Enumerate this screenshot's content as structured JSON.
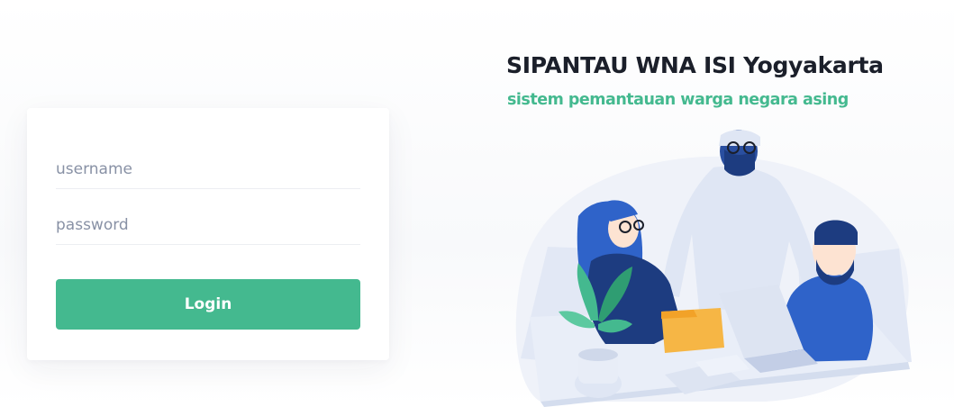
{
  "login": {
    "username_placeholder": "username",
    "password_placeholder": "password",
    "button_label": "Login"
  },
  "header": {
    "title": "SIPANTAU WNA ISI Yogyakarta",
    "subtitle": "sistem pemantauan warga negara asing"
  },
  "illustration": {
    "name": "team-meeting-illustration"
  },
  "colors": {
    "accent": "#44b98f",
    "title": "#1b1f2a",
    "placeholder": "#8891a5",
    "illustration_blue": "#2f63c9",
    "illustration_dark": "#1d3c80",
    "illustration_yellow": "#f6b645"
  }
}
